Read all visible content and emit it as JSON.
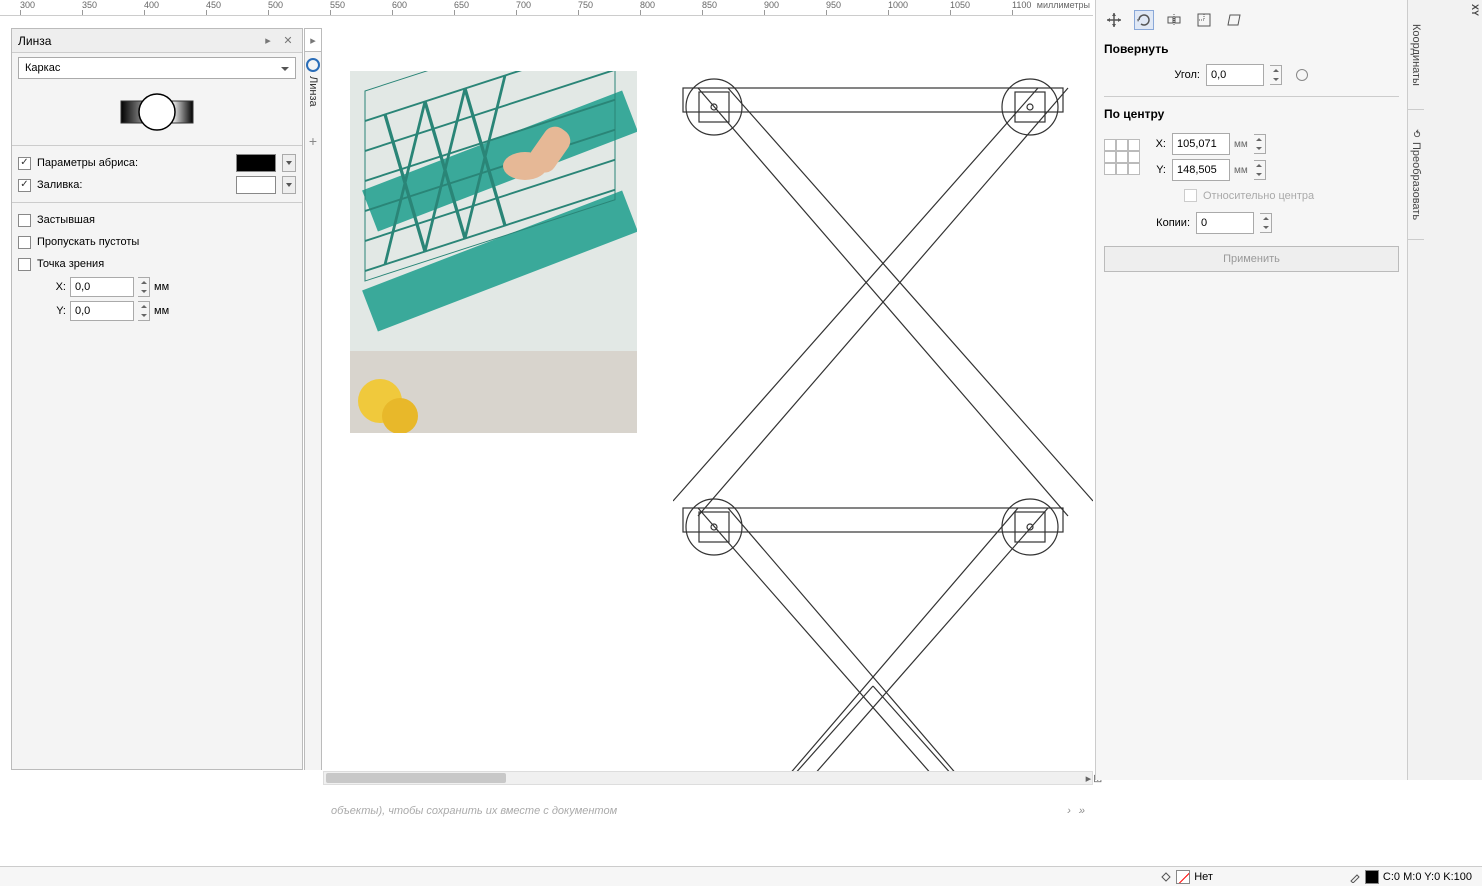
{
  "ruler": {
    "unit_label": "миллиметры",
    "ticks": [
      "300",
      "350",
      "400",
      "450",
      "500",
      "550",
      "600",
      "650",
      "700",
      "750",
      "800",
      "850",
      "900",
      "950",
      "1000",
      "1050",
      "1100"
    ]
  },
  "lens_panel": {
    "title": "Линза",
    "tab_label": "Линза",
    "type_dropdown": "Каркас",
    "outline_label": "Параметры абриса:",
    "outline_checked": true,
    "fill_label": "Заливка:",
    "fill_checked": true,
    "frozen_label": "Застывшая",
    "frozen_checked": false,
    "skip_empty_label": "Пропускать пустоты",
    "skip_empty_checked": false,
    "viewpoint_label": "Точка зрения",
    "viewpoint_checked": false,
    "x_label": "X:",
    "x_value": "0,0",
    "y_label": "Y:",
    "y_value": "0,0",
    "unit": "мм"
  },
  "transform_panel": {
    "icons": [
      "position",
      "rotate",
      "scale-mirror",
      "size",
      "skew"
    ],
    "rotate_title": "Повернуть",
    "angle_label": "Угол:",
    "angle_value": "0,0",
    "center_title": "По центру",
    "x_label": "X:",
    "x_value": "105,071",
    "x_unit": "мм",
    "y_label": "Y:",
    "y_value": "148,505",
    "y_unit": "мм",
    "relative_label": "Относительно центра",
    "relative_checked": false,
    "copies_label": "Копии:",
    "copies_value": "0",
    "apply_label": "Применить"
  },
  "side_tabs": {
    "coords": "Координаты",
    "coords_abbr": "XY",
    "transform": "Преобразовать"
  },
  "hint_text": "объекты), чтобы сохранить их вместе с документом",
  "status": {
    "fill_none": "Нет",
    "outline_text": "C:0 M:0 Y:0 K:100"
  }
}
